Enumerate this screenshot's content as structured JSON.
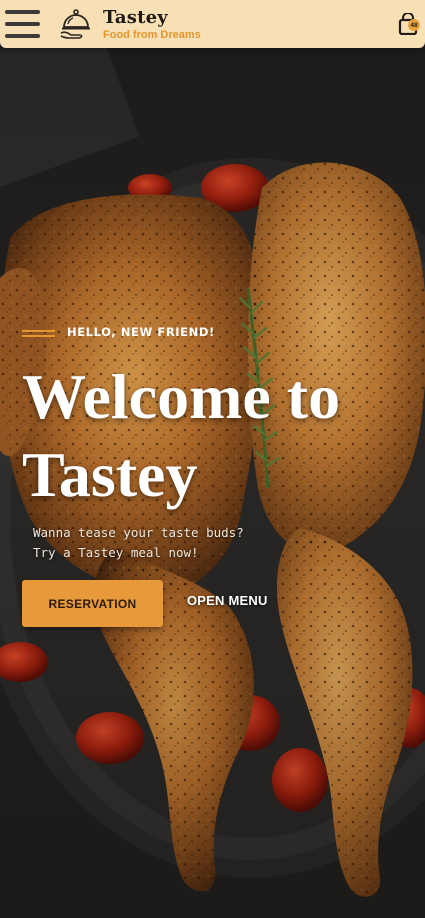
{
  "header": {
    "brand_name": "Tastey",
    "brand_tagline": "Food from Dreams",
    "cart_count": "48",
    "icons": {
      "menu": "hamburger-icon",
      "logo": "cloche-icon",
      "cart": "shopping-bag-icon"
    }
  },
  "hero": {
    "eyebrow": "HELLO, NEW FRIEND!",
    "title_line1": "Welcome to",
    "title_line2": "Tastey",
    "subtitle_line1": "Wanna tease your taste buds?",
    "subtitle_line2": "Try a Tastey meal now!",
    "primary_button": "RESERVATION",
    "secondary_button": "OPEN MENU",
    "image": "roast-chicken-photo"
  },
  "colors": {
    "header_bg": "#f7dfb6",
    "accent": "#e5962e",
    "button": "#e8993a",
    "text_light": "#ffffff"
  }
}
